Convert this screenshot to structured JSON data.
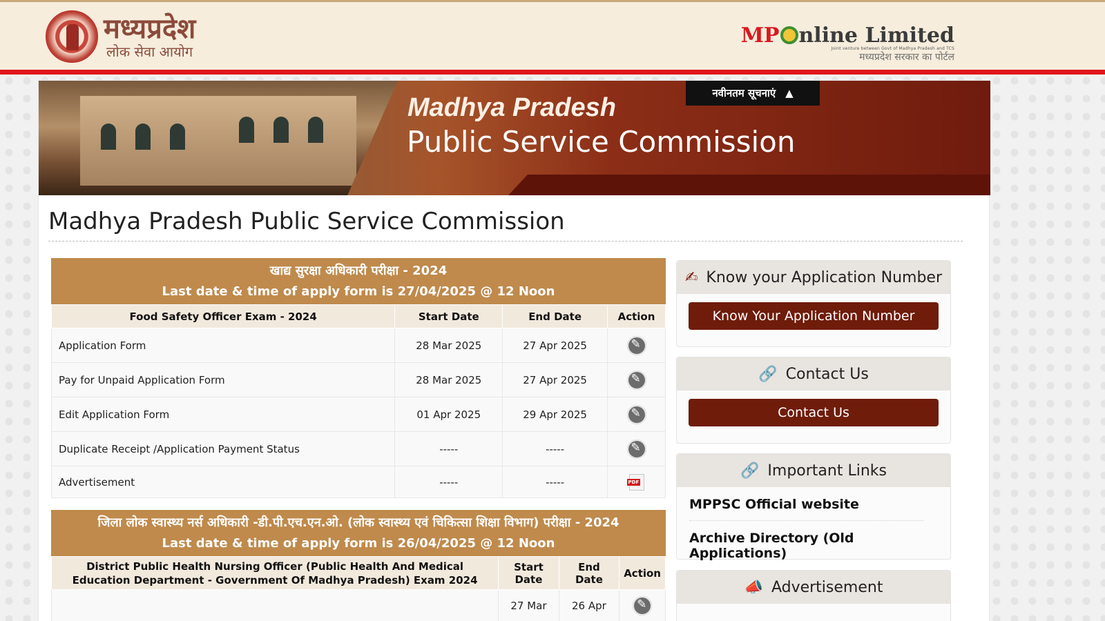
{
  "header": {
    "logo_main": "मध्यप्रदेश",
    "logo_sub": "लोक सेवा आयोग",
    "mponline_mp": "MP",
    "mponline_rest": "nline Limited",
    "mponline_tagline": "Joint venture between Govt of Madhya Pradesh and TCS",
    "mponline_hindi": "मध्यप्रदेश सरकार का पोर्टल"
  },
  "banner": {
    "line1": "Madhya Pradesh",
    "line2": "Public Service Commission",
    "news_tab": "नवीनतम सूचनाएं",
    "news_arrow": "▲"
  },
  "page_title": "Madhya Pradesh Public Service Commission",
  "exam1": {
    "title_hindi": "खाद्य सुरक्षा अधिकारी परीक्षा - 2024",
    "last_date": "Last date & time of apply form is 27/04/2025 @ 12 Noon",
    "columns": [
      "Food Safety Officer Exam - 2024",
      "Start Date",
      "End Date",
      "Action"
    ],
    "rows": [
      {
        "name": "Application Form",
        "start": "28 Mar 2025",
        "end": "27 Apr 2025",
        "icon": "edit-icon"
      },
      {
        "name": "Pay for Unpaid Application Form",
        "start": "28 Mar 2025",
        "end": "27 Apr 2025",
        "icon": "edit-icon"
      },
      {
        "name": "Edit Application Form",
        "start": "01 Apr 2025",
        "end": "29 Apr 2025",
        "icon": "edit-icon"
      },
      {
        "name": "Duplicate Receipt /Application Payment Status",
        "start": "-----",
        "end": "-----",
        "icon": "edit-icon"
      },
      {
        "name": "Advertisement",
        "start": "-----",
        "end": "-----",
        "icon": "pdf-icon"
      }
    ]
  },
  "exam2": {
    "title_hindi": "जिला लोक स्वास्थ्य नर्स अधिकारी -डी.पी.एच.एन.ओ. (लोक स्वास्थ्य एवं चिकित्सा शिक्षा विभाग) परीक्षा - 2024",
    "last_date": "Last date & time of apply form is 26/04/2025 @ 12 Noon",
    "columns": [
      "District Public Health Nursing Officer (Public Health And Medical Education Department - Government Of Madhya Pradesh) Exam 2024",
      "Start Date",
      "End Date",
      "Action"
    ],
    "rows": [
      {
        "name": "",
        "start": "27 Mar",
        "end": "26 Apr",
        "icon": "edit-icon"
      }
    ]
  },
  "sidebar": {
    "app_number": {
      "title": "Know your Application Number",
      "button": "Know Your Application Number",
      "icon": "edit-note-icon"
    },
    "contact": {
      "title": "Contact Us",
      "button": "Contact Us",
      "icon": "link-icon"
    },
    "links": {
      "title": "Important Links",
      "icon": "link-icon",
      "items": [
        "MPPSC Official website",
        "Archive Directory (Old Applications)"
      ]
    },
    "advertisement": {
      "title": "Advertisement",
      "icon": "megaphone-icon"
    }
  }
}
